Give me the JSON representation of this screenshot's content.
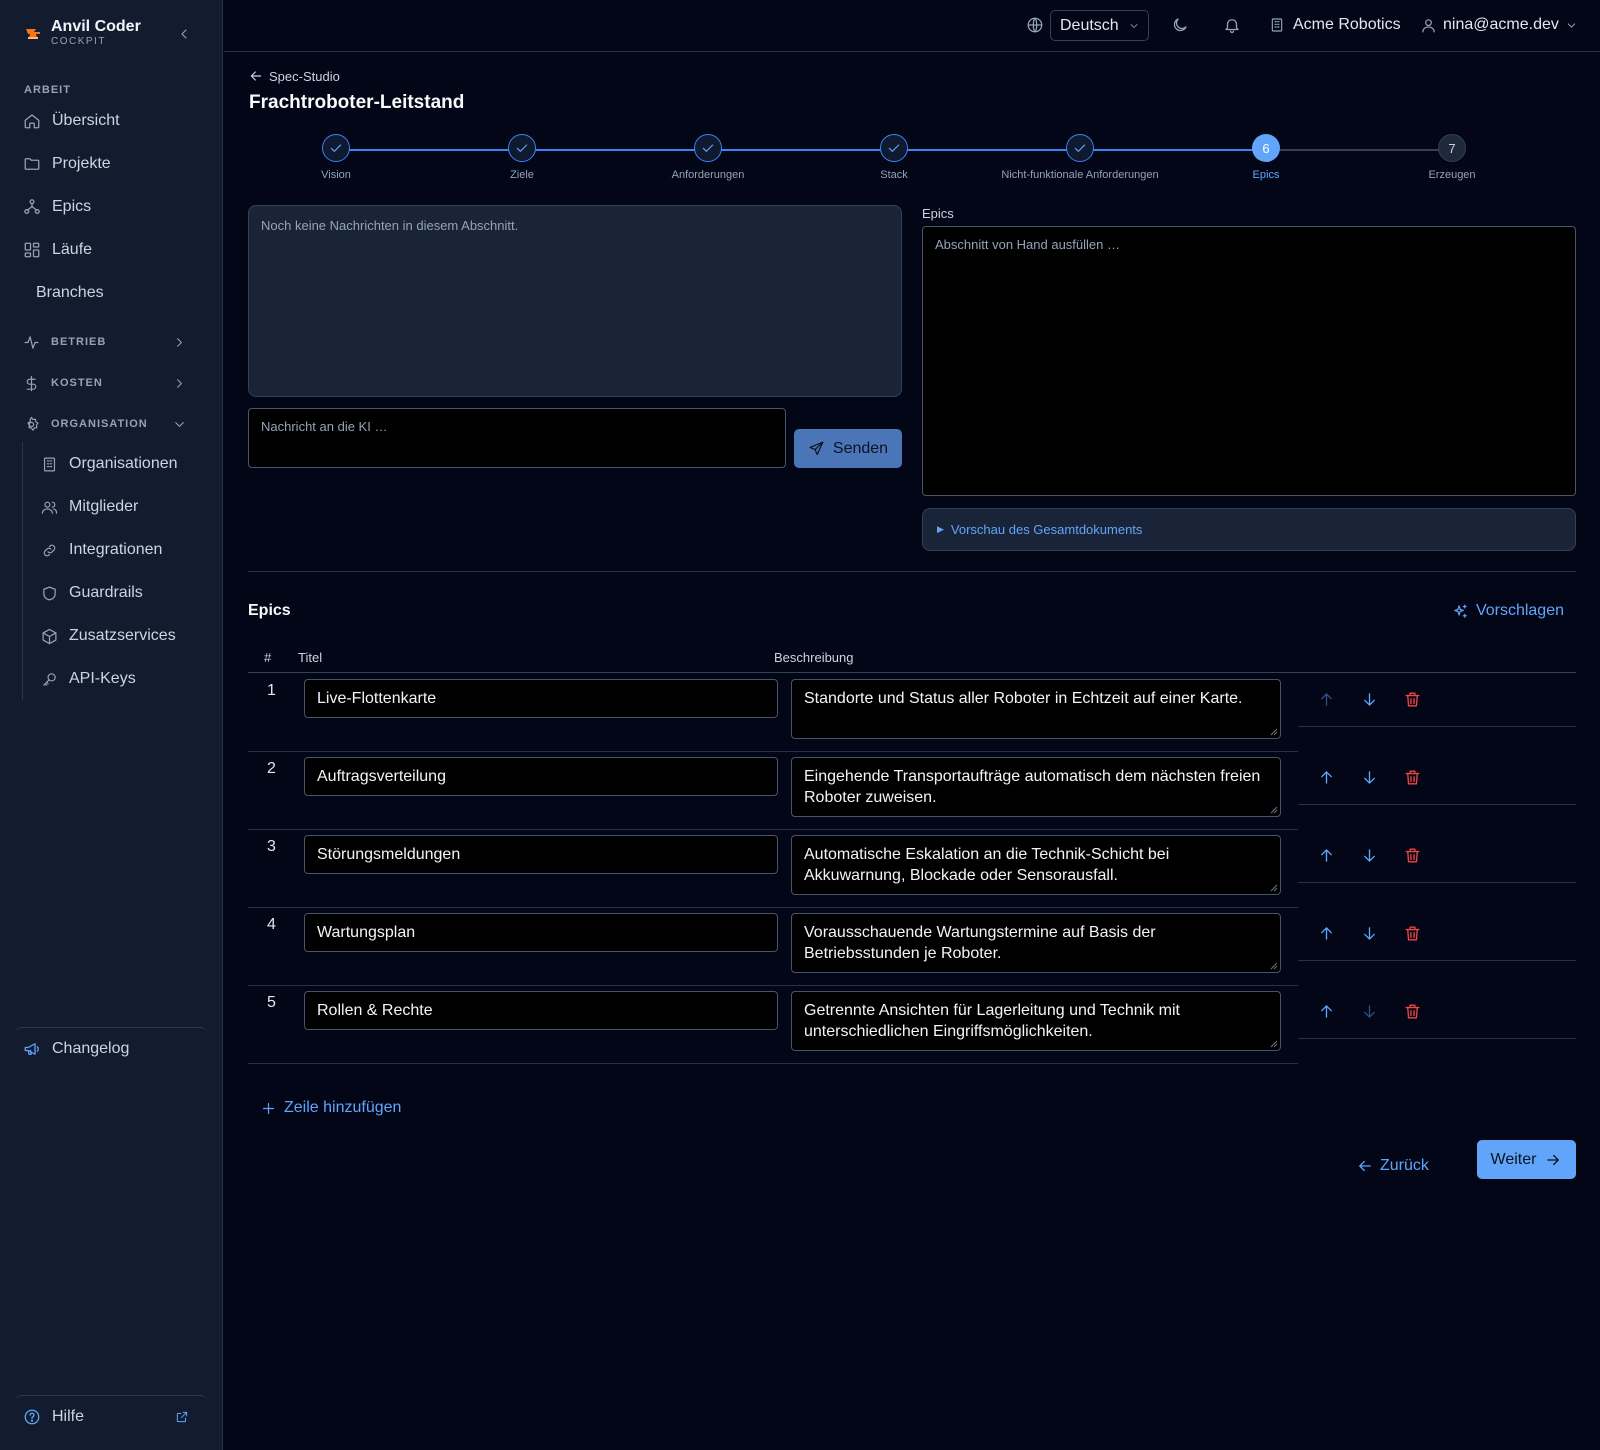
{
  "brand": {
    "name": "Anvil Coder",
    "subtitle": "COCKPIT"
  },
  "sidebar": {
    "section_label": "ARBEIT",
    "items": [
      {
        "label": "Übersicht",
        "icon": "home-icon"
      },
      {
        "label": "Projekte",
        "icon": "folder-icon"
      },
      {
        "label": "Epics",
        "icon": "epics-icon"
      },
      {
        "label": "Läufe",
        "icon": "runs-icon"
      },
      {
        "label": "Branches",
        "icon": ""
      }
    ],
    "groups": [
      {
        "label": "BETRIEB",
        "icon": "activity-icon",
        "expanded": false
      },
      {
        "label": "KOSTEN",
        "icon": "dollar-icon",
        "expanded": false
      },
      {
        "label": "ORGANISATION",
        "icon": "gear-icon",
        "expanded": true
      }
    ],
    "org_items": [
      {
        "label": "Organisationen",
        "icon": "building-icon"
      },
      {
        "label": "Mitglieder",
        "icon": "users-icon"
      },
      {
        "label": "Integrationen",
        "icon": "link-icon"
      },
      {
        "label": "Guardrails",
        "icon": "shield-icon"
      },
      {
        "label": "Zusatzservices",
        "icon": "box-icon"
      },
      {
        "label": "API-Keys",
        "icon": "key-icon"
      }
    ],
    "changelog": "Changelog",
    "help": "Hilfe"
  },
  "topbar": {
    "language": "Deutsch",
    "organization": "Acme Robotics",
    "user": "nina@acme.dev"
  },
  "page": {
    "breadcrumb": "Spec-Studio",
    "title": "Frachtroboter-Leitstand"
  },
  "stepper": {
    "current_index": 5,
    "steps": [
      {
        "label": "Vision",
        "number": "1",
        "state": "done"
      },
      {
        "label": "Ziele",
        "number": "2",
        "state": "done"
      },
      {
        "label": "Anforderungen",
        "number": "3",
        "state": "done"
      },
      {
        "label": "Stack",
        "number": "4",
        "state": "done"
      },
      {
        "label": "Nicht-funktionale Anforderungen",
        "number": "5",
        "state": "done"
      },
      {
        "label": "Epics",
        "number": "6",
        "state": "current"
      },
      {
        "label": "Erzeugen",
        "number": "7",
        "state": "todo"
      }
    ]
  },
  "chat": {
    "empty_text": "Noch keine Nachrichten in diesem Abschnitt.",
    "input_placeholder": "Nachricht an die KI …",
    "send_label": "Senden"
  },
  "section_editor": {
    "label": "Epics",
    "placeholder": "Abschnitt von Hand ausfüllen …",
    "preview_label": "Vorschau des Gesamtdokuments"
  },
  "epics": {
    "title": "Epics",
    "suggest_label": "Vorschlagen",
    "columns": {
      "num": "#",
      "title": "Titel",
      "description": "Beschreibung"
    },
    "rows": [
      {
        "num": "1",
        "title": "Live-Flottenkarte",
        "description": "Standorte und Status aller Roboter in Echtzeit auf einer Karte.",
        "can_up": false,
        "can_down": true
      },
      {
        "num": "2",
        "title": "Auftragsverteilung",
        "description": "Eingehende Transportaufträge automatisch dem nächsten freien Roboter zuweisen.",
        "can_up": true,
        "can_down": true
      },
      {
        "num": "3",
        "title": "Störungsmeldungen",
        "description": "Automatische Eskalation an die Technik-Schicht bei Akkuwarnung, Blockade oder Sensorausfall.",
        "can_up": true,
        "can_down": true
      },
      {
        "num": "4",
        "title": "Wartungsplan",
        "description": "Vorausschauende Wartungstermine auf Basis der Betriebsstunden je Roboter.",
        "can_up": true,
        "can_down": true
      },
      {
        "num": "5",
        "title": "Rollen & Rechte",
        "description": "Getrennte Ansichten für Lagerleitung und Technik mit unterschiedlichen Eingriffsmöglichkeiten.",
        "can_up": true,
        "can_down": false
      }
    ],
    "add_row_label": "Zeile hinzufügen"
  },
  "footer_nav": {
    "back_label": "Zurück",
    "next_label": "Weiter"
  },
  "colors": {
    "accent": "#60a5fa",
    "background": "#020617",
    "sidebar": "#131c2f",
    "danger": "#ef4444",
    "brand_logo": "#f97316"
  }
}
